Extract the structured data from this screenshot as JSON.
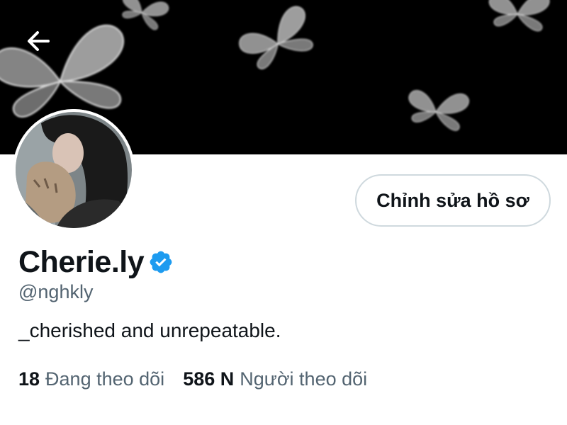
{
  "header": {
    "back_icon": "arrow-left-icon",
    "banner_art": "butterflies-on-black"
  },
  "profile": {
    "display_name": "Cherie.ly",
    "verified_icon": "verified-badge-icon",
    "handle": "@nghkly",
    "bio": "_cherished and unrepeatable.",
    "edit_button_label": "Chỉnh sửa hồ sơ"
  },
  "stats": {
    "following_count": "18",
    "following_label": "Đang theo dõi",
    "followers_count": "586 N",
    "followers_label": "Người theo dõi"
  },
  "colors": {
    "banner": "#000000",
    "text_primary": "#0f1419",
    "text_secondary": "#536471",
    "verified": "#1d9bf0",
    "button_border": "#cfd9de"
  }
}
